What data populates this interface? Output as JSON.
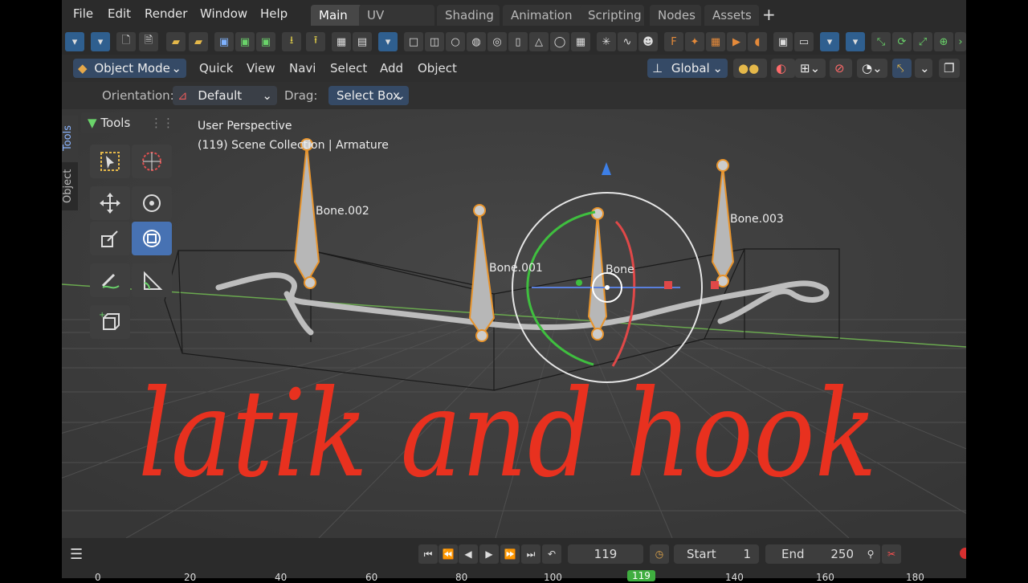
{
  "menubar": {
    "items": [
      "File",
      "Edit",
      "Render",
      "Window",
      "Help"
    ],
    "workspace_tabs": [
      "Main",
      "UV Editing",
      "Shading",
      "Animation",
      "Scripting",
      "Nodes",
      "Assets"
    ],
    "active_tab": "Main",
    "add_tab_icon": "plus-icon"
  },
  "header": {
    "mode": "Object Mode",
    "menus": [
      "Quick",
      "View",
      "Navi",
      "Select",
      "Add",
      "Object"
    ],
    "orientation": "Global"
  },
  "options": {
    "orientation_label": "Orientation:",
    "orientation_value": "Default",
    "drag_label": "Drag:",
    "drag_value": "Select Box"
  },
  "sidebar": {
    "tabs": [
      "Tools",
      "Object"
    ],
    "tools_title": "Tools"
  },
  "viewport": {
    "perspective": "User Perspective",
    "collection": "(119) Scene Collection | Armature",
    "bones": [
      "Bone.002",
      "Bone.001",
      "Bone",
      "Bone.003"
    ],
    "overlay_text": "latik and hook",
    "overlay_color": "#e8311f"
  },
  "timeline": {
    "current_frame": "119",
    "start_label": "Start",
    "start_value": "1",
    "end_label": "End",
    "end_value": "250",
    "ruler": [
      "0",
      "20",
      "40",
      "60",
      "80",
      "100",
      "119",
      "140",
      "160",
      "180"
    ]
  },
  "colors": {
    "accent": "#4772b3",
    "bone_outline": "#e8942c",
    "rope": "#bdbdbd"
  }
}
